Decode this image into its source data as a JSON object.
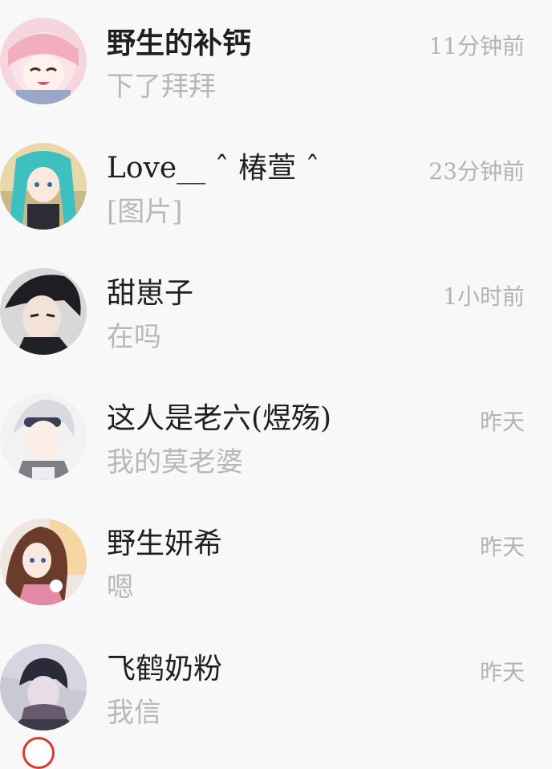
{
  "conversations": [
    {
      "name": "野生的补钙",
      "time": "11分钟前",
      "message": "下了拜拜",
      "avatar_icon": "anime-girl-pink-avatar"
    },
    {
      "name": "Love__ ˆ 椿萱 ˆ",
      "time": "23分钟前",
      "message": "[图片]",
      "avatar_icon": "anime-girl-teal-avatar"
    },
    {
      "name": "甜崽子",
      "time": "1小时前",
      "message": "在吗",
      "avatar_icon": "anime-boy-dark-avatar"
    },
    {
      "name": "这人是老六(煜殇)",
      "time": "昨天",
      "message": "我的莫老婆",
      "avatar_icon": "anime-boy-white-hair-avatar"
    },
    {
      "name": "野生妍希",
      "time": "昨天",
      "message": "嗯",
      "avatar_icon": "anime-girl-brown-hair-avatar"
    },
    {
      "name": "飞鹤奶粉",
      "time": "昨天",
      "message": "我信",
      "avatar_icon": "anime-boy-scarf-avatar"
    }
  ],
  "colors": {
    "background": "#f8f8f8",
    "name_text": "#1f1f1f",
    "secondary_text": "#b8b8b8"
  }
}
